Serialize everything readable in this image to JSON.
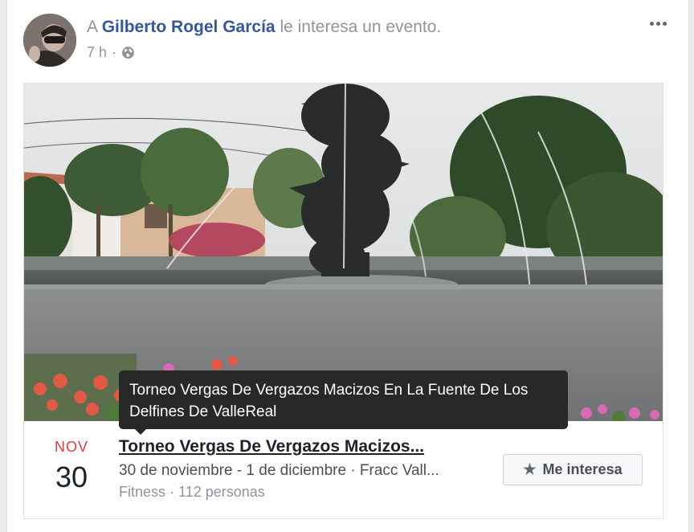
{
  "post": {
    "prefix": "A",
    "actor": "Gilberto Rogel García",
    "action": "le interesa un evento.",
    "time": "7 h",
    "separator": "·",
    "privacy_icon": "globe-icon",
    "menu_icon": "more-horizontal-icon"
  },
  "event": {
    "month": "NOV",
    "day": "30",
    "title": "Torneo Vergas De Vergazos Macizos...",
    "date_place": "30 de noviembre - 1 de diciembre · Fracc Vall...",
    "category": "Fitness · 112 personas",
    "interest_button": "Me interesa",
    "interest_icon": "star-icon"
  },
  "tooltip": {
    "text": "Torneo Vergas De Vergazos Macizos En La Fuente De Los Delfines De ValleReal"
  },
  "colors": {
    "link": "#365899",
    "month": "#e0393e",
    "tooltip_bg": "#282828"
  }
}
